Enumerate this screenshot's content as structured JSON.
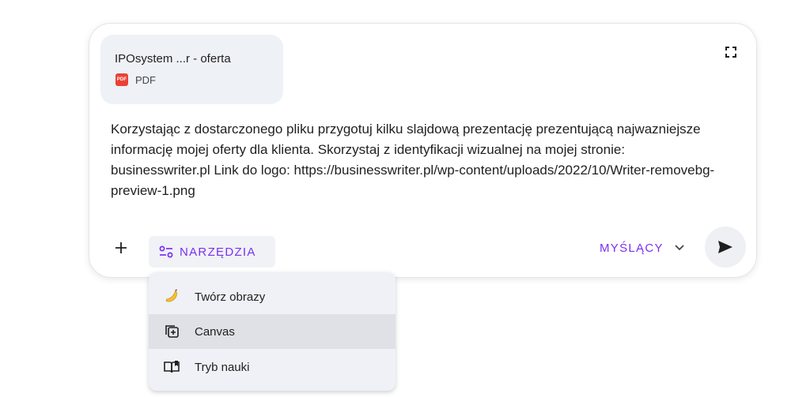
{
  "attachment": {
    "file_name": "IPOsystem ...r - oferta",
    "file_type": "PDF",
    "file_icon_text": "PDF"
  },
  "prompt": {
    "text": "Korzystając z dostarczonego pliku przygotuj kilku slajdową prezentację prezentującą najwazniejsze informację mojej oferty dla klienta. Skorzystaj z identyfikacji wizualnej na mojej stronie: businesswriter.pl Link do logo: https://businesswriter.pl/wp-content/uploads/2022/10/Writer-removebg-preview-1.png"
  },
  "toolbar": {
    "tools_label": "NARZĘDZIA",
    "mode_label": "MYŚLĄCY"
  },
  "tools_menu": {
    "items": [
      {
        "label": "Twórz obrazy",
        "icon": "banana-icon"
      },
      {
        "label": "Canvas",
        "icon": "canvas-icon"
      },
      {
        "label": "Tryb nauki",
        "icon": "book-icon"
      }
    ],
    "highlighted_index": 1
  },
  "colors": {
    "accent": "#7b2ff2",
    "pdf_red": "#e94235",
    "chip_bg": "#eef1f6",
    "menu_bg": "#eff1f6",
    "menu_highlight": "#dfe1e6"
  }
}
